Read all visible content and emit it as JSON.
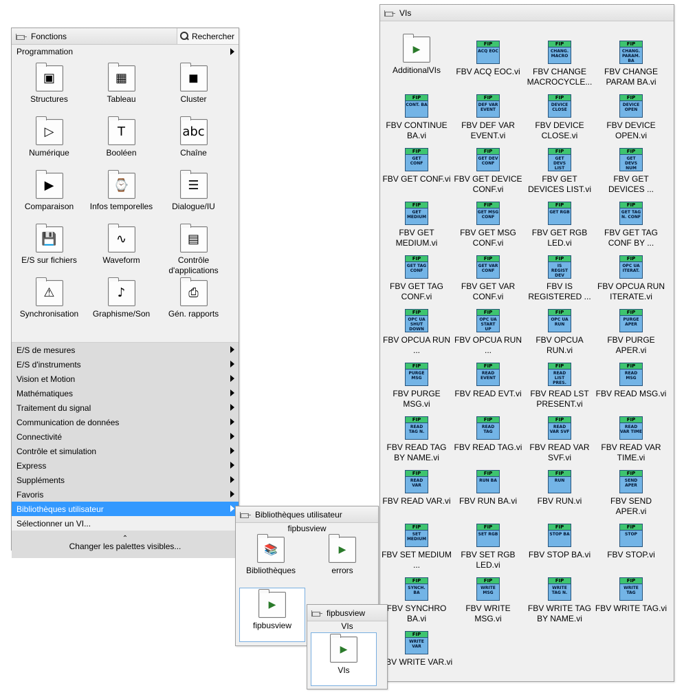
{
  "fonctions": {
    "title": "Fonctions",
    "search_label": "Rechercher",
    "category": "Programmation",
    "items": [
      {
        "label": "Structures",
        "icon": "structures-icon",
        "glyph": "▣"
      },
      {
        "label": "Tableau",
        "icon": "array-icon",
        "glyph": "▦"
      },
      {
        "label": "Cluster",
        "icon": "cluster-icon",
        "glyph": "◼"
      },
      {
        "label": "Numérique",
        "icon": "numeric-icon",
        "glyph": "▷"
      },
      {
        "label": "Booléen",
        "icon": "boolean-icon",
        "glyph": "T"
      },
      {
        "label": "Chaîne",
        "icon": "string-icon",
        "glyph": "abc"
      },
      {
        "label": "Comparaison",
        "icon": "comparison-icon",
        "glyph": "▶"
      },
      {
        "label": "Infos temporelles",
        "icon": "timing-icon",
        "glyph": "⌚"
      },
      {
        "label": "Dialogue/IU",
        "icon": "dialog-icon",
        "glyph": "☰"
      },
      {
        "label": "E/S sur fichiers",
        "icon": "file-io-icon",
        "glyph": "💾"
      },
      {
        "label": "Waveform",
        "icon": "waveform-icon",
        "glyph": "∿"
      },
      {
        "label": "Contrôle d'applications",
        "icon": "app-control-icon",
        "glyph": "▤"
      },
      {
        "label": "Synchronisation",
        "icon": "sync-icon",
        "glyph": "⚠"
      },
      {
        "label": "Graphisme/Son",
        "icon": "graphics-sound-icon",
        "glyph": "♪"
      },
      {
        "label": "Gén. rapports",
        "icon": "report-icon",
        "glyph": "⎙"
      }
    ],
    "menu": [
      {
        "label": "E/S de mesures",
        "arrow": true
      },
      {
        "label": "E/S d'instruments",
        "arrow": true
      },
      {
        "label": "Vision et Motion",
        "arrow": true
      },
      {
        "label": "Mathématiques",
        "arrow": true
      },
      {
        "label": "Traitement du signal",
        "arrow": true
      },
      {
        "label": "Communication de données",
        "arrow": true
      },
      {
        "label": "Connectivité",
        "arrow": true
      },
      {
        "label": "Contrôle et simulation",
        "arrow": true
      },
      {
        "label": "Express",
        "arrow": true
      },
      {
        "label": "Suppléments",
        "arrow": true
      },
      {
        "label": "Favoris",
        "arrow": true
      },
      {
        "label": "Bibliothèques utilisateur",
        "arrow": true,
        "selected": true
      },
      {
        "label": "Sélectionner un VI...",
        "arrow": false
      }
    ],
    "footer": "Changer les palettes visibles...",
    "chevron": "⌃"
  },
  "biblio": {
    "title": "Bibliothèques utilisateur",
    "subtitle": "fipbusview",
    "items": [
      {
        "label": "Bibliothèques",
        "icon": "books-icon"
      },
      {
        "label": "errors",
        "icon": "vi-folder-icon"
      },
      {
        "label": "fipbusview",
        "icon": "vi-folder-icon"
      }
    ]
  },
  "fipbusview": {
    "title": "fipbusview",
    "subtitle": "VIs",
    "item": "VIs"
  },
  "vis": {
    "title": "VIs",
    "first": "AdditionalVIs",
    "items": [
      {
        "label": "FBV ACQ EOC.vi",
        "tag": "ACQ EOC"
      },
      {
        "label": "FBV CHANGE MACROCYCLE...",
        "tag": "CHANG. MACRO"
      },
      {
        "label": "FBV CHANGE PARAM BA.vi",
        "tag": "CHANG. PARAM. BA"
      },
      {
        "label": "FBV CONTINUE BA.vi",
        "tag": "CONT. BA"
      },
      {
        "label": "FBV DEF VAR EVENT.vi",
        "tag": "DEF VAR EVENT"
      },
      {
        "label": "FBV DEVICE CLOSE.vi",
        "tag": "DEVICE CLOSE"
      },
      {
        "label": "FBV DEVICE OPEN.vi",
        "tag": "DEVICE OPEN"
      },
      {
        "label": "FBV GET CONF.vi",
        "tag": "GET CONF"
      },
      {
        "label": "FBV GET DEVICE CONF.vi",
        "tag": "GET DEV CONF"
      },
      {
        "label": "FBV GET DEVICES LIST.vi",
        "tag": "GET DEVS LIST"
      },
      {
        "label": "FBV GET DEVICES ...",
        "tag": "GET DEVS NUM"
      },
      {
        "label": "FBV GET MEDIUM.vi",
        "tag": "GET MEDIUM"
      },
      {
        "label": "FBV GET MSG CONF.vi",
        "tag": "GET MSG CONF"
      },
      {
        "label": "FBV GET RGB LED.vi",
        "tag": "GET RGB"
      },
      {
        "label": "FBV GET TAG CONF BY ...",
        "tag": "GET TAG N. CONF"
      },
      {
        "label": "FBV GET TAG CONF.vi",
        "tag": "GET TAG CONF"
      },
      {
        "label": "FBV GET VAR CONF.vi",
        "tag": "GET VAR CONF"
      },
      {
        "label": "FBV IS REGISTERED ...",
        "tag": "IS REGIST DEV"
      },
      {
        "label": "FBV OPCUA RUN ITERATE.vi",
        "tag": "OPC UA ITERAT."
      },
      {
        "label": "FBV OPCUA RUN ...",
        "tag": "OPC UA SHUT DOWN"
      },
      {
        "label": "FBV OPCUA RUN ...",
        "tag": "OPC UA START UP"
      },
      {
        "label": "FBV OPCUA RUN.vi",
        "tag": "OPC UA RUN"
      },
      {
        "label": "FBV PURGE APER.vi",
        "tag": "PURGE APER"
      },
      {
        "label": "FBV PURGE MSG.vi",
        "tag": "PURGE MSG"
      },
      {
        "label": "FBV READ EVT.vi",
        "tag": "READ EVENT"
      },
      {
        "label": "FBV READ LST PRESENT.vi",
        "tag": "READ LIST PRES."
      },
      {
        "label": "FBV READ MSG.vi",
        "tag": "READ MSG"
      },
      {
        "label": "FBV READ TAG BY NAME.vi",
        "tag": "READ TAG N."
      },
      {
        "label": "FBV READ TAG.vi",
        "tag": "READ TAG"
      },
      {
        "label": "FBV READ VAR SVF.vi",
        "tag": "READ VAR SVF"
      },
      {
        "label": "FBV READ VAR TIME.vi",
        "tag": "READ VAR TIME"
      },
      {
        "label": "FBV READ VAR.vi",
        "tag": "READ VAR"
      },
      {
        "label": "FBV RUN BA.vi",
        "tag": "RUN BA"
      },
      {
        "label": "FBV RUN.vi",
        "tag": "RUN"
      },
      {
        "label": "FBV SEND APER.vi",
        "tag": "SEND APER"
      },
      {
        "label": "FBV SET MEDIUM ...",
        "tag": "SET MEDIUM"
      },
      {
        "label": "FBV SET RGB LED.vi",
        "tag": "SET RGB"
      },
      {
        "label": "FBV STOP BA.vi",
        "tag": "STOP BA"
      },
      {
        "label": "FBV STOP.vi",
        "tag": "STOP"
      },
      {
        "label": "FBV SYNCHRO BA.vi",
        "tag": "SYNCH. BA"
      },
      {
        "label": "FBV WRITE MSG.vi",
        "tag": "WRITE MSG"
      },
      {
        "label": "FBV WRITE TAG BY NAME.vi",
        "tag": "WRITE TAG N."
      },
      {
        "label": "FBV WRITE TAG.vi",
        "tag": "WRITE TAG"
      },
      {
        "label": "FBV WRITE VAR.vi",
        "tag": "WRITE VAR"
      }
    ],
    "fip_label": "FIP"
  }
}
